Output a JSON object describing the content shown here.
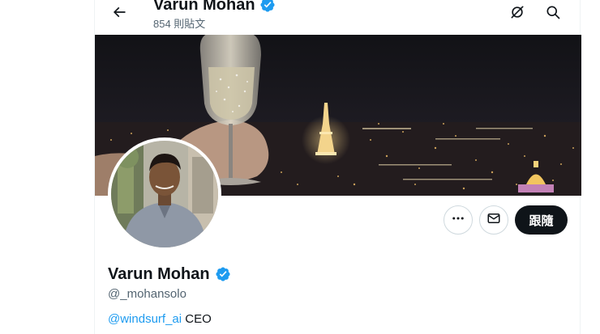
{
  "header": {
    "title": "Varun Mohan",
    "post_count": "854 則貼文"
  },
  "profile": {
    "display_name": "Varun Mohan",
    "handle": "@_mohansolo",
    "bio_mention": "@windsurf_ai",
    "bio_text": " CEO",
    "follow_label": "跟隨",
    "verified": true
  },
  "icons": {
    "back": "arrow-left-icon",
    "grok": "grok-icon",
    "search": "search-icon",
    "more": "more-icon",
    "message": "envelope-icon",
    "verified": "verified-badge-icon"
  },
  "colors": {
    "accent": "#1d9bf0",
    "follow_button": "#0f1419",
    "secondary_text": "#536471"
  }
}
